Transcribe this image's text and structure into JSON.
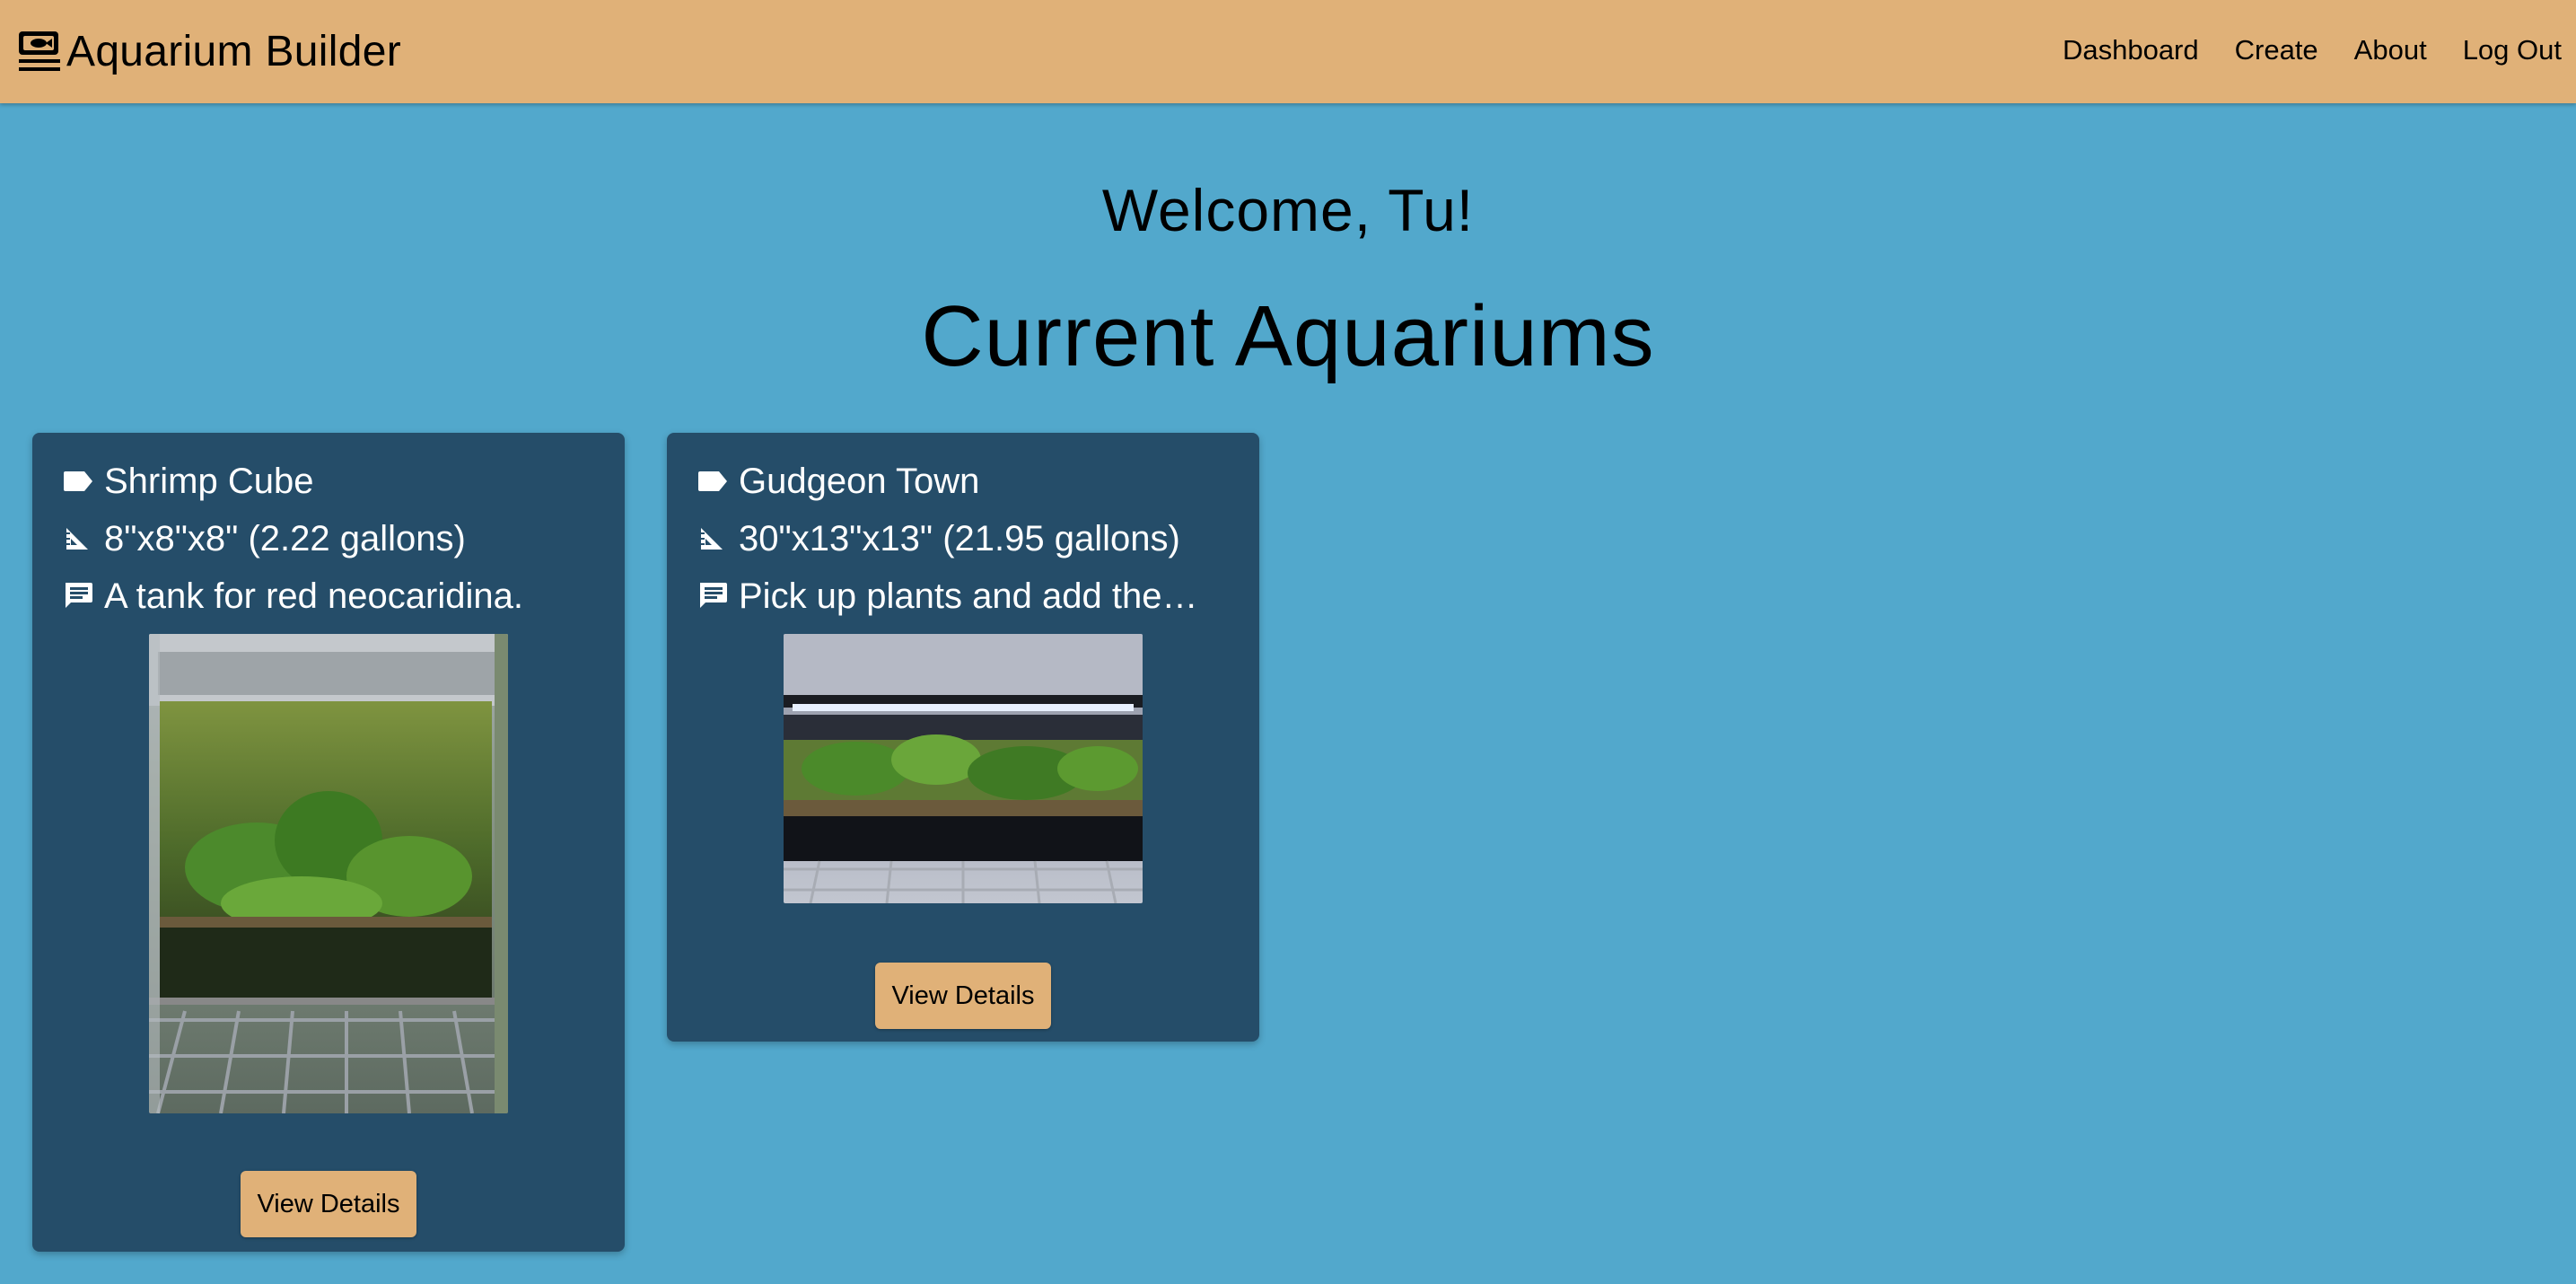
{
  "app": {
    "brand": "Aquarium Builder"
  },
  "nav": {
    "links": [
      "Dashboard",
      "Create",
      "About",
      "Log Out"
    ]
  },
  "main": {
    "welcome": "Welcome, Tu!",
    "section_title": "Current Aquariums"
  },
  "aquariums": [
    {
      "name": "Shrimp Cube",
      "dimensions": "8\"x8\"x8\" (2.22 gallons)",
      "description": "A tank for red neocaridina.",
      "button_label": "View Details"
    },
    {
      "name": "Gudgeon Town",
      "dimensions": "30\"x13\"x13\" (21.95 gallons)",
      "description": "Pick up plants and add the…",
      "button_label": "View Details"
    }
  ],
  "icons": {
    "brand": "aquarium-tank-icon",
    "name": "label-tag-icon",
    "dimensions": "set-square-ruler-icon",
    "description": "comment-icon"
  },
  "colors": {
    "navbar": "#e0b178",
    "background": "#52a8cc",
    "card": "#254d69",
    "button": "#e0b178"
  }
}
